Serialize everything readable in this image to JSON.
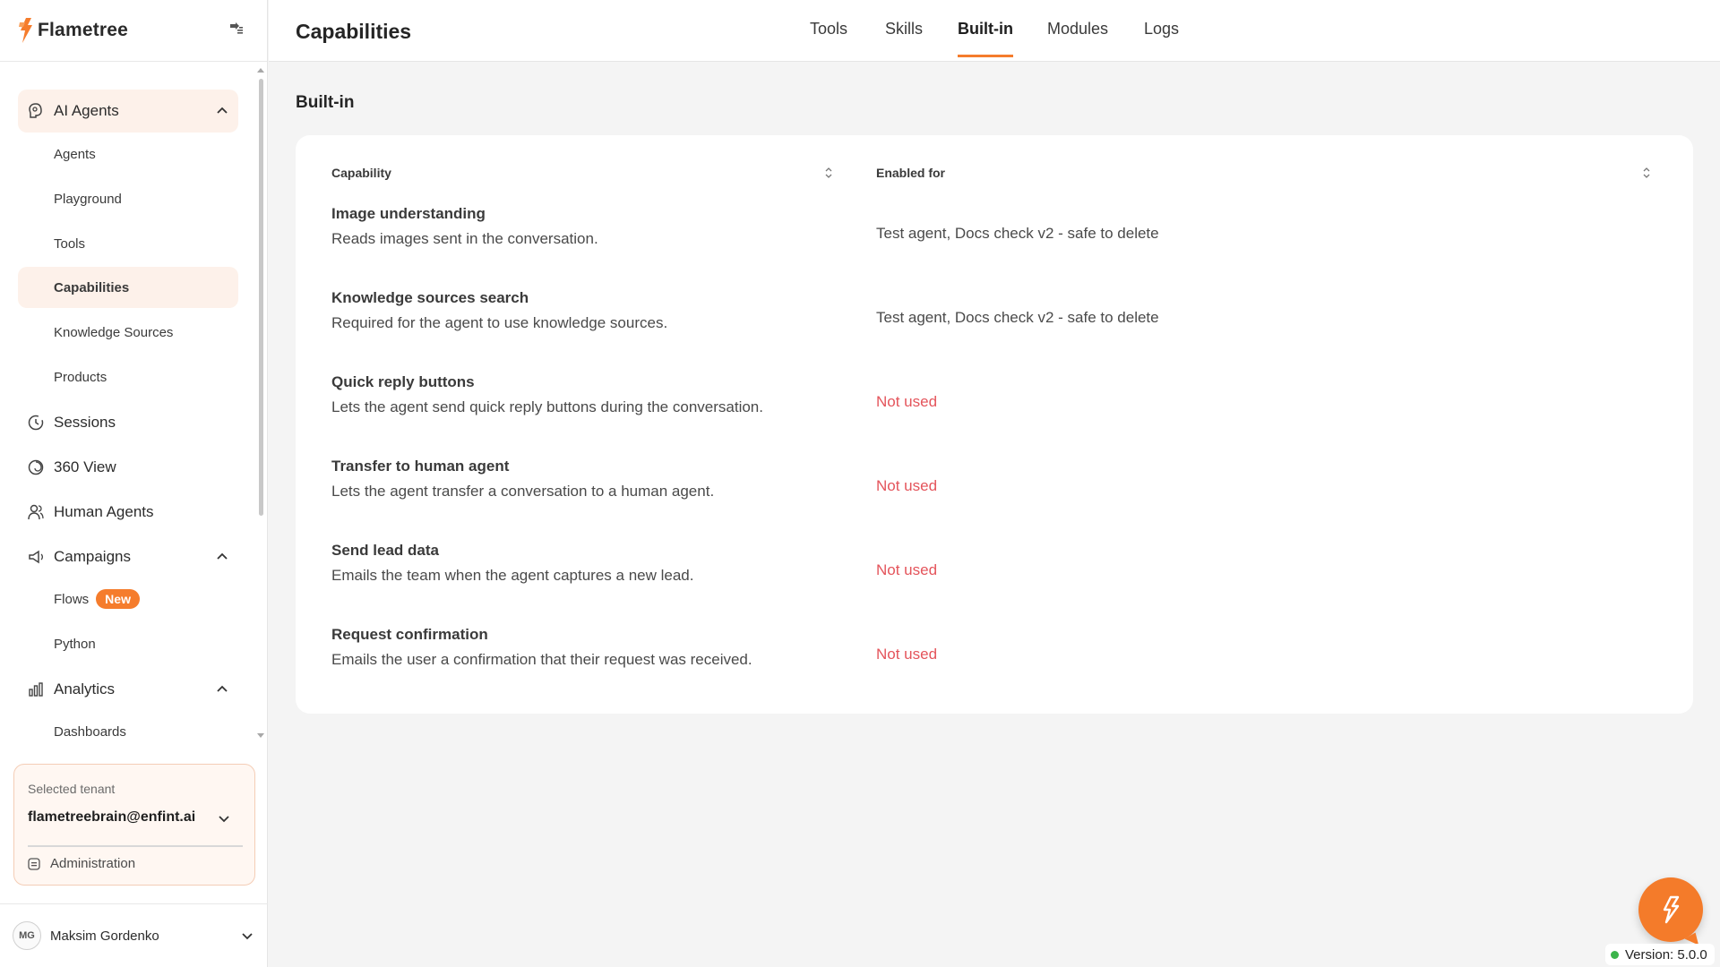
{
  "brand": {
    "name": "Flametree"
  },
  "sidebar": {
    "groups": [
      {
        "label": "AI Agents",
        "children": [
          "Agents",
          "Playground",
          "Tools",
          "Capabilities",
          "Knowledge Sources",
          "Products"
        ]
      },
      {
        "label": "Sessions"
      },
      {
        "label": "360 View"
      },
      {
        "label": "Human Agents"
      },
      {
        "label": "Campaigns",
        "children": [
          "Flows",
          "Python"
        ]
      },
      {
        "label": "Analytics",
        "children": [
          "Dashboards"
        ]
      }
    ],
    "flows_badge": "New",
    "active_item": "Capabilities"
  },
  "tenant": {
    "label": "Selected tenant",
    "value": "flametreebrain@enfint.ai",
    "admin_label": "Administration"
  },
  "user": {
    "initials": "MG",
    "name": "Maksim Gordenko"
  },
  "header": {
    "title": "Capabilities",
    "tabs": [
      "Tools",
      "Skills",
      "Built-in",
      "Modules",
      "Logs"
    ],
    "active_tab": "Built-in"
  },
  "section": {
    "title": "Built-in"
  },
  "table": {
    "columns": [
      "Capability",
      "Enabled for"
    ],
    "rows": [
      {
        "name": "Image understanding",
        "description": "Reads images sent in the conversation.",
        "enabled_for": "Test agent, Docs check v2 - safe to delete",
        "used": true
      },
      {
        "name": "Knowledge sources search",
        "description": "Required for the agent to use knowledge sources.",
        "enabled_for": "Test agent, Docs check v2 - safe to delete",
        "used": true
      },
      {
        "name": "Quick reply buttons",
        "description": "Lets the agent send quick reply buttons during the conversation.",
        "enabled_for": "Not used",
        "used": false
      },
      {
        "name": "Transfer to human agent",
        "description": "Lets the agent transfer a conversation to a human agent.",
        "enabled_for": "Not used",
        "used": false
      },
      {
        "name": "Send lead data",
        "description": "Emails the team when the agent captures a new lead.",
        "enabled_for": "Not used",
        "used": false
      },
      {
        "name": "Request confirmation",
        "description": "Emails the user a confirmation that their request was received.",
        "enabled_for": "Not used",
        "used": false
      }
    ]
  },
  "version": {
    "label": "Version: 5.0.0",
    "status_color": "#3cb44b"
  },
  "colors": {
    "accent": "#f57c2c",
    "unused": "#e4545b",
    "active_bg": "#fdf1ea"
  }
}
